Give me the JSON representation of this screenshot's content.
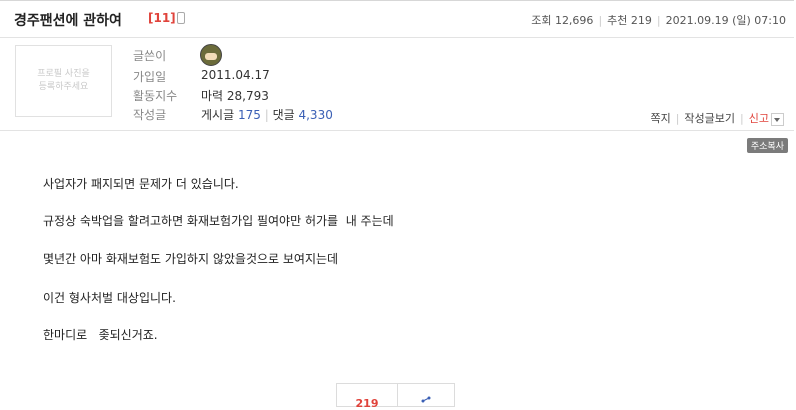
{
  "post": {
    "title": "경주팬션에 관하여",
    "comment_count": "[11]"
  },
  "meta": {
    "views": "조회 12,696",
    "recommends": "추천 219",
    "date": "2021.09.19 (일) 07:10"
  },
  "profile": {
    "placeholder": "프로필 사진을\n등록하주세요",
    "labels": {
      "author": "글쓴이",
      "joined": "가입일",
      "activity": "활동지수",
      "writings": "작성글"
    },
    "joined_value": "2011.04.17",
    "activity_value": "마력 28,793",
    "posts_label": "게시글",
    "posts_count": "175",
    "comments_label": "댓글",
    "comments_count": "4,330"
  },
  "actions": {
    "message": "쪽지",
    "view_posts": "작성글보기",
    "report": "신고"
  },
  "copy_url": "주소복사",
  "body": [
    "사업자가 패지되면 문제가 더 있습니다.",
    "규정상 숙박업을 할려고하면 화재보험가입 필여야만 허가를  내 주는데",
    "몇년간 아마 화재보험도 가입하지 않았을것으로 보여지는데",
    "이건 형사처벌 대상입니다.",
    "한마디로   좆되신거죠."
  ],
  "vote": {
    "count": "219"
  },
  "icons": {
    "mobile": "mobile-icon",
    "share": "share-icon",
    "dropdown": "chevron-down-icon",
    "avatar": "avatar-icon"
  }
}
